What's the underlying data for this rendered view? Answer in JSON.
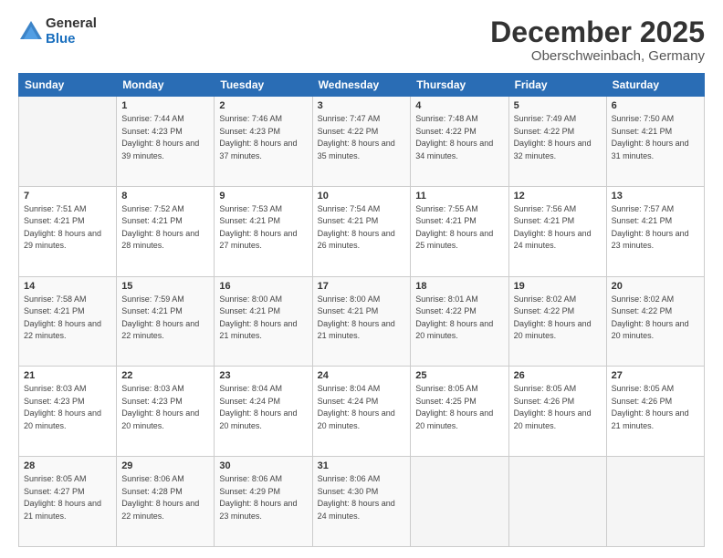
{
  "logo": {
    "general": "General",
    "blue": "Blue"
  },
  "header": {
    "month": "December 2025",
    "location": "Oberschweinbach, Germany"
  },
  "days_of_week": [
    "Sunday",
    "Monday",
    "Tuesday",
    "Wednesday",
    "Thursday",
    "Friday",
    "Saturday"
  ],
  "weeks": [
    [
      {
        "day": "",
        "sunrise": "",
        "sunset": "",
        "daylight": ""
      },
      {
        "day": "1",
        "sunrise": "Sunrise: 7:44 AM",
        "sunset": "Sunset: 4:23 PM",
        "daylight": "Daylight: 8 hours and 39 minutes."
      },
      {
        "day": "2",
        "sunrise": "Sunrise: 7:46 AM",
        "sunset": "Sunset: 4:23 PM",
        "daylight": "Daylight: 8 hours and 37 minutes."
      },
      {
        "day": "3",
        "sunrise": "Sunrise: 7:47 AM",
        "sunset": "Sunset: 4:22 PM",
        "daylight": "Daylight: 8 hours and 35 minutes."
      },
      {
        "day": "4",
        "sunrise": "Sunrise: 7:48 AM",
        "sunset": "Sunset: 4:22 PM",
        "daylight": "Daylight: 8 hours and 34 minutes."
      },
      {
        "day": "5",
        "sunrise": "Sunrise: 7:49 AM",
        "sunset": "Sunset: 4:22 PM",
        "daylight": "Daylight: 8 hours and 32 minutes."
      },
      {
        "day": "6",
        "sunrise": "Sunrise: 7:50 AM",
        "sunset": "Sunset: 4:21 PM",
        "daylight": "Daylight: 8 hours and 31 minutes."
      }
    ],
    [
      {
        "day": "7",
        "sunrise": "Sunrise: 7:51 AM",
        "sunset": "Sunset: 4:21 PM",
        "daylight": "Daylight: 8 hours and 29 minutes."
      },
      {
        "day": "8",
        "sunrise": "Sunrise: 7:52 AM",
        "sunset": "Sunset: 4:21 PM",
        "daylight": "Daylight: 8 hours and 28 minutes."
      },
      {
        "day": "9",
        "sunrise": "Sunrise: 7:53 AM",
        "sunset": "Sunset: 4:21 PM",
        "daylight": "Daylight: 8 hours and 27 minutes."
      },
      {
        "day": "10",
        "sunrise": "Sunrise: 7:54 AM",
        "sunset": "Sunset: 4:21 PM",
        "daylight": "Daylight: 8 hours and 26 minutes."
      },
      {
        "day": "11",
        "sunrise": "Sunrise: 7:55 AM",
        "sunset": "Sunset: 4:21 PM",
        "daylight": "Daylight: 8 hours and 25 minutes."
      },
      {
        "day": "12",
        "sunrise": "Sunrise: 7:56 AM",
        "sunset": "Sunset: 4:21 PM",
        "daylight": "Daylight: 8 hours and 24 minutes."
      },
      {
        "day": "13",
        "sunrise": "Sunrise: 7:57 AM",
        "sunset": "Sunset: 4:21 PM",
        "daylight": "Daylight: 8 hours and 23 minutes."
      }
    ],
    [
      {
        "day": "14",
        "sunrise": "Sunrise: 7:58 AM",
        "sunset": "Sunset: 4:21 PM",
        "daylight": "Daylight: 8 hours and 22 minutes."
      },
      {
        "day": "15",
        "sunrise": "Sunrise: 7:59 AM",
        "sunset": "Sunset: 4:21 PM",
        "daylight": "Daylight: 8 hours and 22 minutes."
      },
      {
        "day": "16",
        "sunrise": "Sunrise: 8:00 AM",
        "sunset": "Sunset: 4:21 PM",
        "daylight": "Daylight: 8 hours and 21 minutes."
      },
      {
        "day": "17",
        "sunrise": "Sunrise: 8:00 AM",
        "sunset": "Sunset: 4:21 PM",
        "daylight": "Daylight: 8 hours and 21 minutes."
      },
      {
        "day": "18",
        "sunrise": "Sunrise: 8:01 AM",
        "sunset": "Sunset: 4:22 PM",
        "daylight": "Daylight: 8 hours and 20 minutes."
      },
      {
        "day": "19",
        "sunrise": "Sunrise: 8:02 AM",
        "sunset": "Sunset: 4:22 PM",
        "daylight": "Daylight: 8 hours and 20 minutes."
      },
      {
        "day": "20",
        "sunrise": "Sunrise: 8:02 AM",
        "sunset": "Sunset: 4:22 PM",
        "daylight": "Daylight: 8 hours and 20 minutes."
      }
    ],
    [
      {
        "day": "21",
        "sunrise": "Sunrise: 8:03 AM",
        "sunset": "Sunset: 4:23 PM",
        "daylight": "Daylight: 8 hours and 20 minutes."
      },
      {
        "day": "22",
        "sunrise": "Sunrise: 8:03 AM",
        "sunset": "Sunset: 4:23 PM",
        "daylight": "Daylight: 8 hours and 20 minutes."
      },
      {
        "day": "23",
        "sunrise": "Sunrise: 8:04 AM",
        "sunset": "Sunset: 4:24 PM",
        "daylight": "Daylight: 8 hours and 20 minutes."
      },
      {
        "day": "24",
        "sunrise": "Sunrise: 8:04 AM",
        "sunset": "Sunset: 4:24 PM",
        "daylight": "Daylight: 8 hours and 20 minutes."
      },
      {
        "day": "25",
        "sunrise": "Sunrise: 8:05 AM",
        "sunset": "Sunset: 4:25 PM",
        "daylight": "Daylight: 8 hours and 20 minutes."
      },
      {
        "day": "26",
        "sunrise": "Sunrise: 8:05 AM",
        "sunset": "Sunset: 4:26 PM",
        "daylight": "Daylight: 8 hours and 20 minutes."
      },
      {
        "day": "27",
        "sunrise": "Sunrise: 8:05 AM",
        "sunset": "Sunset: 4:26 PM",
        "daylight": "Daylight: 8 hours and 21 minutes."
      }
    ],
    [
      {
        "day": "28",
        "sunrise": "Sunrise: 8:05 AM",
        "sunset": "Sunset: 4:27 PM",
        "daylight": "Daylight: 8 hours and 21 minutes."
      },
      {
        "day": "29",
        "sunrise": "Sunrise: 8:06 AM",
        "sunset": "Sunset: 4:28 PM",
        "daylight": "Daylight: 8 hours and 22 minutes."
      },
      {
        "day": "30",
        "sunrise": "Sunrise: 8:06 AM",
        "sunset": "Sunset: 4:29 PM",
        "daylight": "Daylight: 8 hours and 23 minutes."
      },
      {
        "day": "31",
        "sunrise": "Sunrise: 8:06 AM",
        "sunset": "Sunset: 4:30 PM",
        "daylight": "Daylight: 8 hours and 24 minutes."
      },
      {
        "day": "",
        "sunrise": "",
        "sunset": "",
        "daylight": ""
      },
      {
        "day": "",
        "sunrise": "",
        "sunset": "",
        "daylight": ""
      },
      {
        "day": "",
        "sunrise": "",
        "sunset": "",
        "daylight": ""
      }
    ]
  ]
}
